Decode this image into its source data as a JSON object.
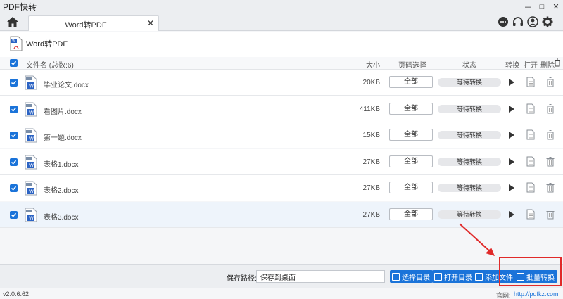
{
  "window": {
    "title": "PDF快转",
    "minimize": "－",
    "restore": "□",
    "close": "✕"
  },
  "tabs": [
    {
      "label": "Word转PDF",
      "close": "✕"
    }
  ],
  "header": {
    "title": "Word转PDF"
  },
  "table": {
    "columns": {
      "name": "文件名 (总数:6)",
      "size": "大小",
      "page_select": "页码选择",
      "status": "状态",
      "convert": "转换",
      "open": "打开",
      "delete": "删除"
    },
    "rows": [
      {
        "name": "毕业论文.docx",
        "size": "20KB",
        "page_select": "全部",
        "status": "等待转换",
        "checked": true
      },
      {
        "name": "看图片.docx",
        "size": "411KB",
        "page_select": "全部",
        "status": "等待转换",
        "checked": true
      },
      {
        "name": "第一题.docx",
        "size": "15KB",
        "page_select": "全部",
        "status": "等待转换",
        "checked": true
      },
      {
        "name": "表格1.docx",
        "size": "27KB",
        "page_select": "全部",
        "status": "等待转换",
        "checked": true
      },
      {
        "name": "表格2.docx",
        "size": "27KB",
        "page_select": "全部",
        "status": "等待转换",
        "checked": true
      },
      {
        "name": "表格3.docx",
        "size": "27KB",
        "page_select": "全部",
        "status": "等待转换",
        "checked": true,
        "selected": true
      }
    ]
  },
  "footer": {
    "save_path_label": "保存路径:",
    "save_path_value": "保存到桌面",
    "choose_dir": "选择目录",
    "open_dir": "打开目录",
    "add_file": "添加文件",
    "batch_convert": "批量转换"
  },
  "statusbar": {
    "version": "v2.0.6.62",
    "site_label": "官网:",
    "site_url": "http://pdfkz.com"
  },
  "colors": {
    "accent": "#1a73d9",
    "highlight": "#e02a2a"
  }
}
